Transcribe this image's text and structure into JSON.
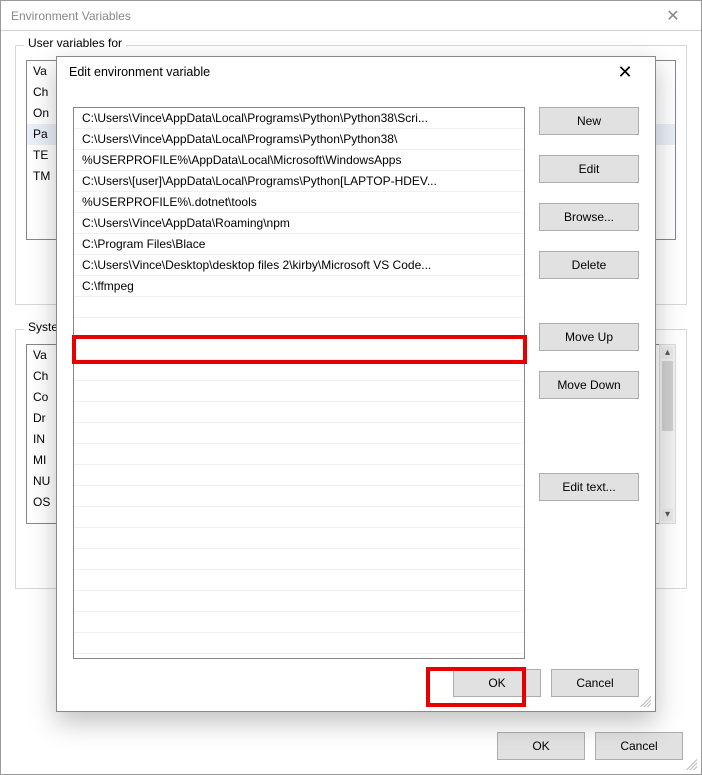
{
  "outer": {
    "title": "Environment Variables",
    "close_glyph": "✕",
    "user_group_label": "User variables for",
    "sys_group_label": "System variables",
    "user_vars": [
      "Va",
      "Ch",
      "On",
      "Pa",
      "TE",
      "TM"
    ],
    "user_selected_index": 3,
    "sys_vars": [
      "Va",
      "Ch",
      "Co",
      "Dr",
      "IN",
      "MI",
      "NU",
      "OS"
    ],
    "buttons": {
      "ok": "OK",
      "cancel": "Cancel"
    }
  },
  "modal": {
    "title": "Edit environment variable",
    "close_glyph": "✕",
    "paths": [
      "C:\\Users\\Vince\\AppData\\Local\\Programs\\Python\\Python38\\Scri...",
      "C:\\Users\\Vince\\AppData\\Local\\Programs\\Python\\Python38\\",
      "%USERPROFILE%\\AppData\\Local\\Microsoft\\WindowsApps",
      "C:\\Users\\[user]\\AppData\\Local\\Programs\\Python[LAPTOP-HDEV...",
      "%USERPROFILE%\\.dotnet\\tools",
      "C:\\Users\\Vince\\AppData\\Roaming\\npm",
      "C:\\Program Files\\Blace",
      "C:\\Users\\Vince\\Desktop\\desktop files 2\\kirby\\Microsoft VS Code...",
      "C:\\ffmpeg"
    ],
    "buttons": {
      "new": "New",
      "edit": "Edit",
      "browse": "Browse...",
      "delete": "Delete",
      "move_up": "Move Up",
      "move_down": "Move Down",
      "edit_text": "Edit text...",
      "ok": "OK",
      "cancel": "Cancel"
    }
  }
}
